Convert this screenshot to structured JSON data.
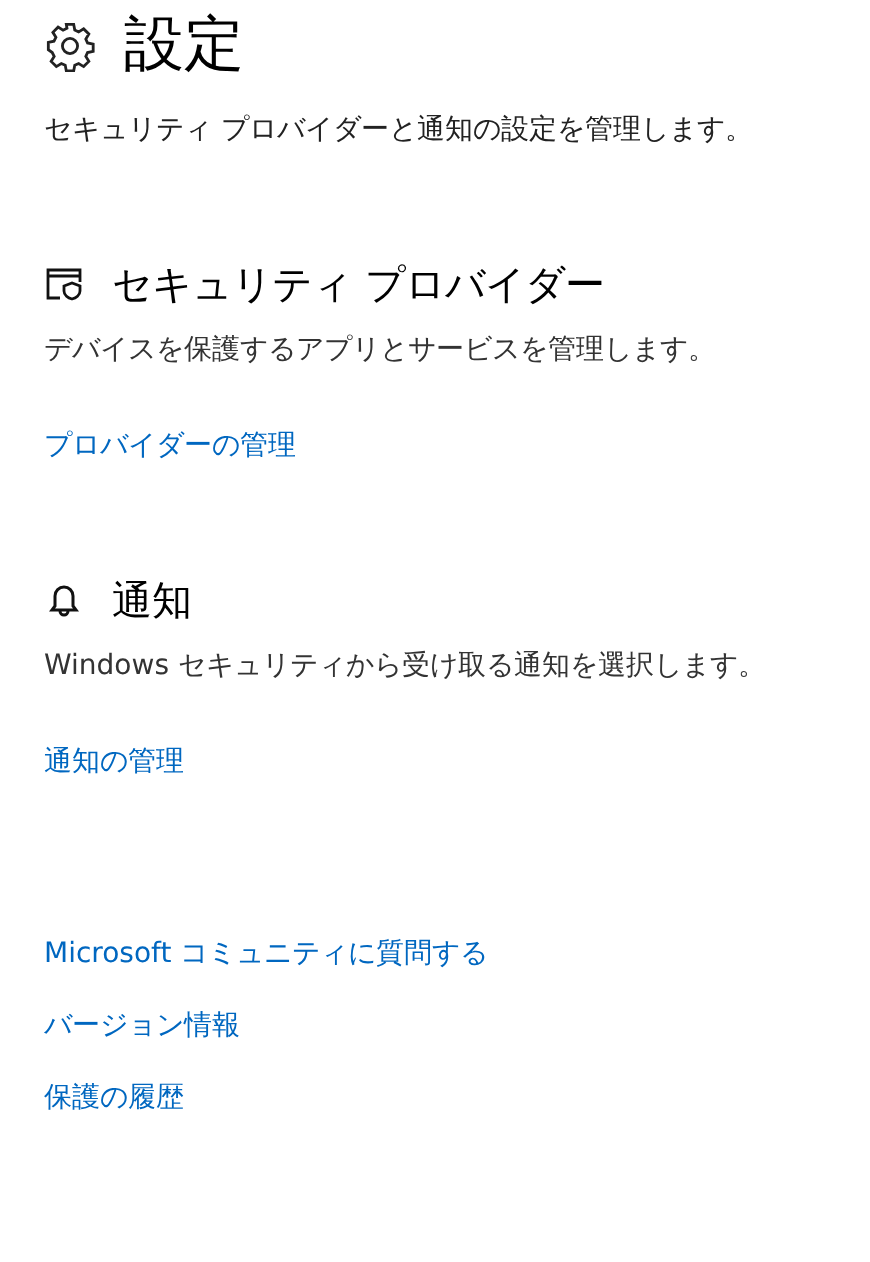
{
  "header": {
    "title": "設定",
    "subtitle": "セキュリティ プロバイダーと通知の設定を管理します。"
  },
  "sections": [
    {
      "kind": "shield",
      "title": "セキュリティ プロバイダー",
      "description": "デバイスを保護するアプリとサービスを管理します。",
      "link": "プロバイダーの管理"
    },
    {
      "kind": "bell",
      "title": "通知",
      "description": "Windows セキュリティから受け取る通知を選択します。",
      "link": "通知の管理"
    }
  ],
  "footer_links": [
    "Microsoft コミュニティに質問する",
    "バージョン情報",
    "保護の履歴"
  ]
}
